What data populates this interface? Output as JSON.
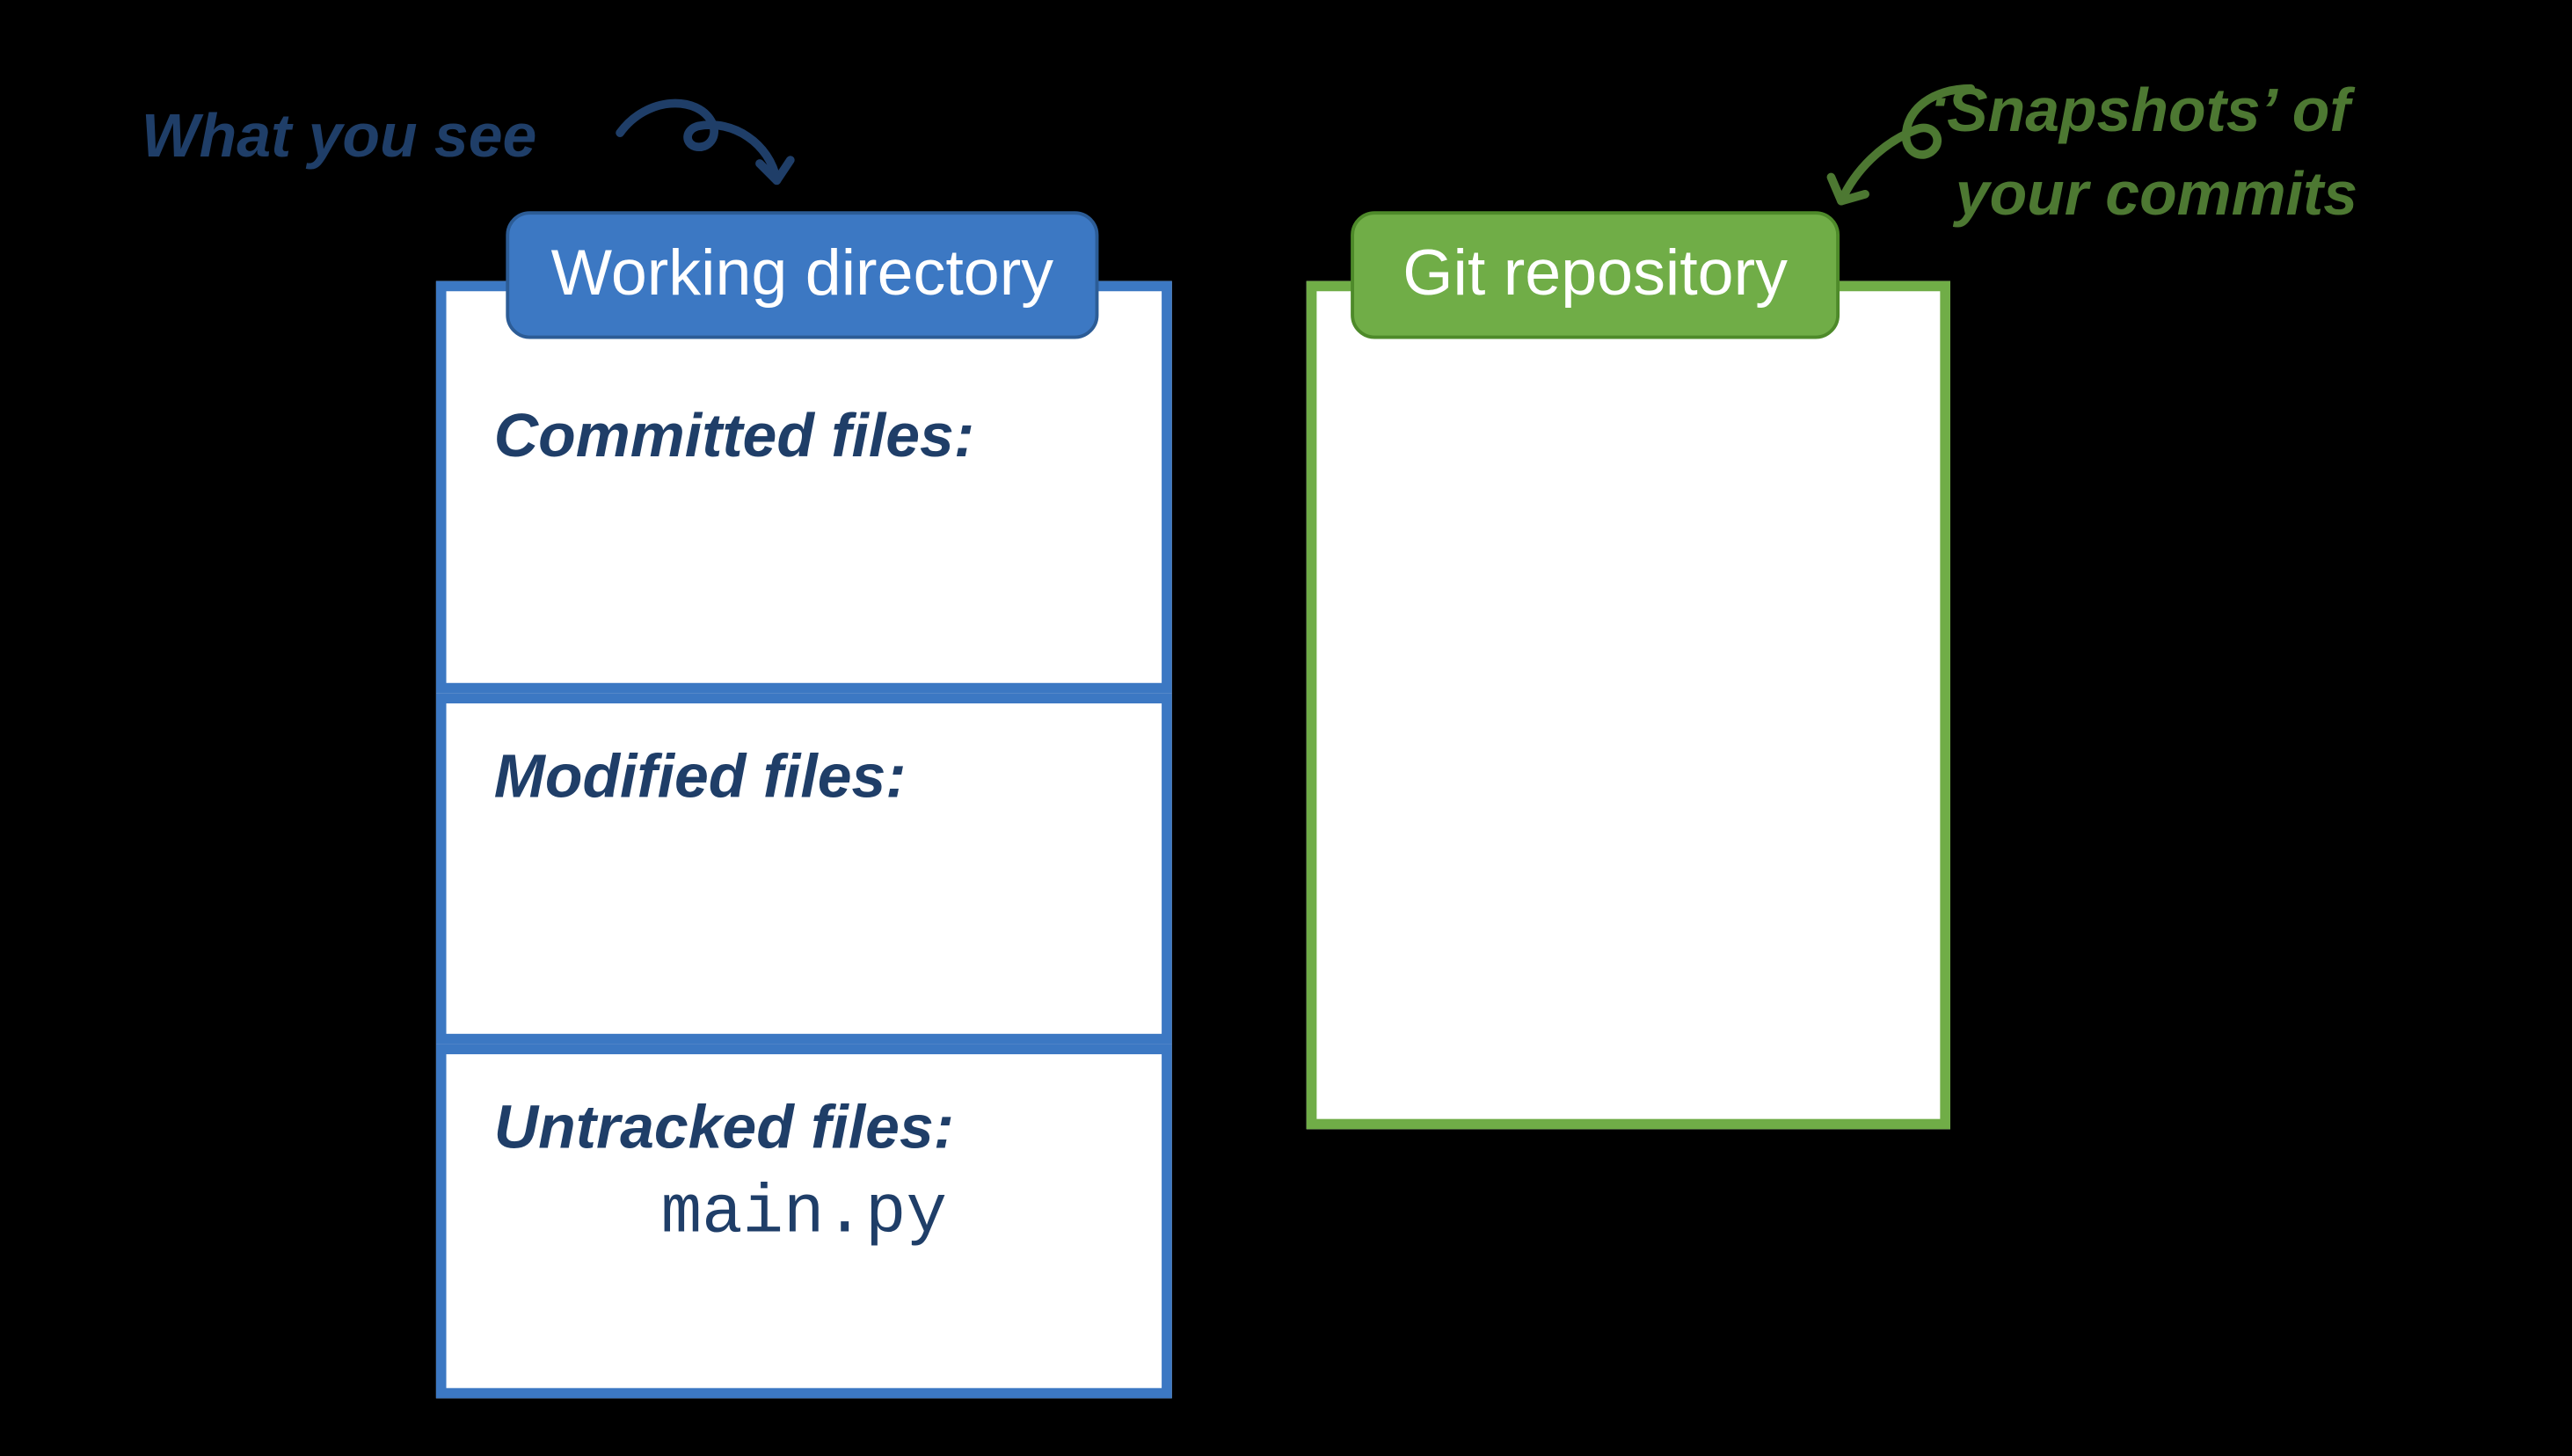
{
  "callouts": {
    "left": "What you see",
    "right_line1": "‘Snapshots’ of",
    "right_line2": "your commits"
  },
  "working_directory": {
    "tab_label": "Working directory",
    "sections": {
      "committed_label": "Committed files:",
      "modified_label": "Modified files:",
      "untracked_label": "Untracked files:",
      "untracked_files": [
        "main.py"
      ]
    }
  },
  "repository": {
    "tab_label": "Git repository"
  },
  "colors": {
    "blue": "#3C78C3",
    "green": "#70AD47",
    "dark_blue": "#1F3E68",
    "dark_green": "#4D7832"
  }
}
